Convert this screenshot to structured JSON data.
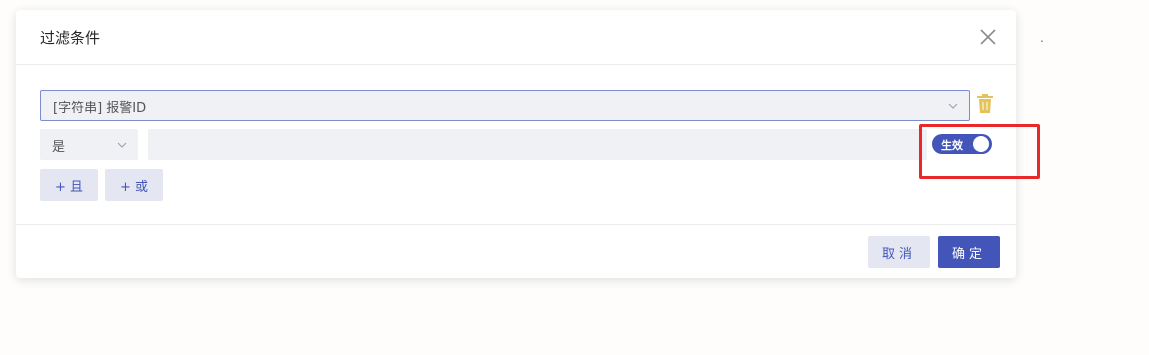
{
  "dialog": {
    "title": "过滤条件",
    "close_icon": "close-icon"
  },
  "condition": {
    "field_value": "[字符串] 报警ID",
    "operator_value": "是",
    "value_input": "",
    "toggle_label": "生效",
    "toggle_on": true,
    "delete_icon": "trash-icon",
    "delete_color": "#e3c35a"
  },
  "add_buttons": {
    "and_label": "+ 且",
    "or_label": "+ 或"
  },
  "footer": {
    "cancel_label": "取消",
    "ok_label": "确定"
  },
  "colors": {
    "primary": "#4355b8",
    "highlight": "#e8282b"
  },
  "stray_mark": "."
}
